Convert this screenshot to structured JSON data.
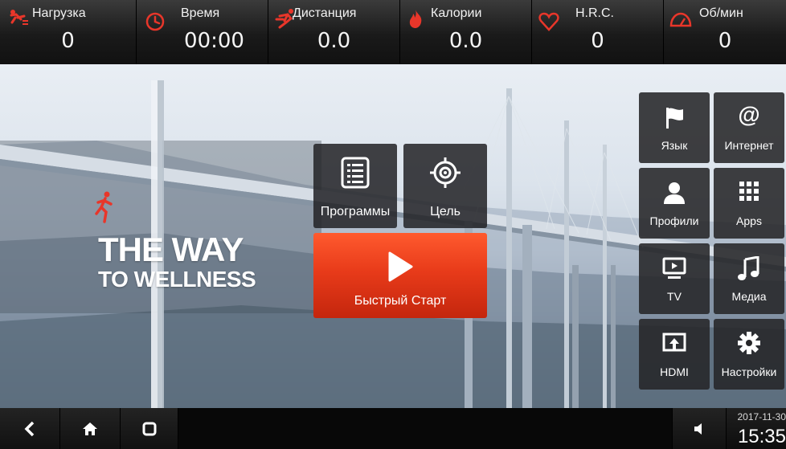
{
  "stats": [
    {
      "label": "Нагрузка",
      "value": "0",
      "icon": "incline-icon"
    },
    {
      "label": "Время",
      "value": "00:00",
      "icon": "clock-icon"
    },
    {
      "label": "Дистанция",
      "value": "0.0",
      "icon": "runner-icon"
    },
    {
      "label": "Калории",
      "value": "0.0",
      "icon": "flame-icon"
    },
    {
      "label": "H.R.C.",
      "value": "0",
      "icon": "heart-icon"
    },
    {
      "label": "Об/мин",
      "value": "0",
      "icon": "speedometer-icon"
    }
  ],
  "brand": {
    "line1": "THE WAY",
    "line2": "TO WELLNESS"
  },
  "center": {
    "programs_label": "Программы",
    "goal_label": "Цель",
    "quick_start_label": "Быстрый Старт"
  },
  "right_menu": [
    {
      "label": "Язык",
      "icon": "flag-icon"
    },
    {
      "label": "Интернет",
      "icon": "at-icon"
    },
    {
      "label": "Профили",
      "icon": "person-icon"
    },
    {
      "label": "Apps",
      "icon": "grid-icon"
    },
    {
      "label": "TV",
      "icon": "tv-icon"
    },
    {
      "label": "Медиа",
      "icon": "music-icon"
    },
    {
      "label": "HDMI",
      "icon": "hdmi-icon"
    },
    {
      "label": "Настройки",
      "icon": "gear-icon"
    }
  ],
  "status": {
    "date": "2017-11-30",
    "time": "15:35"
  },
  "colors": {
    "accent": "#e83b1a",
    "icon_red": "#e8362a"
  }
}
